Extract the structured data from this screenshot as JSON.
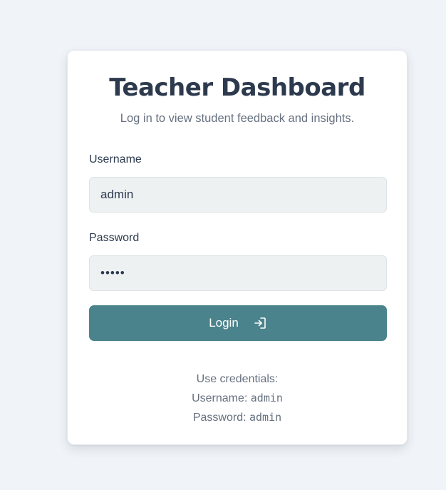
{
  "login": {
    "title": "Teacher Dashboard",
    "subtitle": "Log in to view student feedback and insights.",
    "username_label": "Username",
    "username_value": "admin",
    "password_label": "Password",
    "password_value": "admin",
    "login_button_label": "Login",
    "login_icon": "login-arrow-icon"
  },
  "credentials": {
    "heading": "Use credentials:",
    "username_prefix": "Username:",
    "username": "admin",
    "password_prefix": "Password:",
    "password": "admin"
  },
  "colors": {
    "page_background": "#f0f4f8",
    "card_background": "#ffffff",
    "accent": "#4a838b",
    "title_text": "#2d3a4e",
    "muted_text": "#66707f",
    "input_background": "#edf1f2"
  }
}
